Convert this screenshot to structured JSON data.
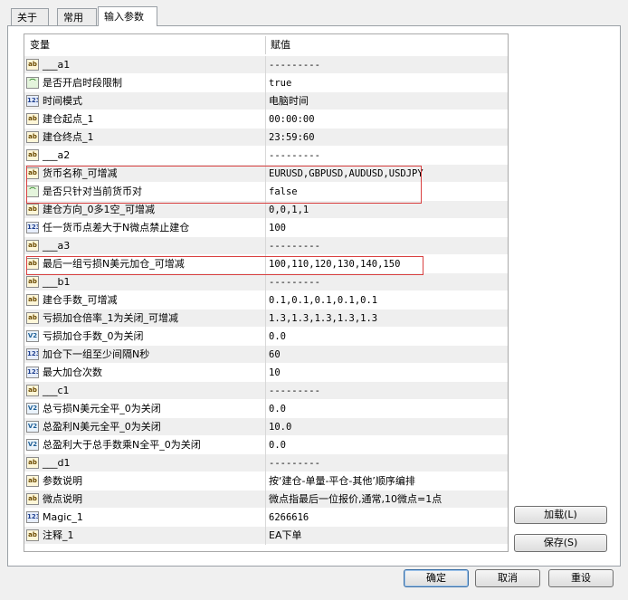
{
  "tabs": [
    "关于",
    "常用",
    "输入参数"
  ],
  "grid": {
    "columns": [
      "变量",
      "赋值"
    ],
    "rows": [
      {
        "icon": "ab",
        "name": "___a1",
        "value": "---------"
      },
      {
        "icon": "bool",
        "name": "是否开启时段限制",
        "value": "true"
      },
      {
        "icon": "123",
        "name": "时间模式",
        "value": "电脑时间"
      },
      {
        "icon": "ab",
        "name": "建仓起点_1",
        "value": "00:00:00"
      },
      {
        "icon": "ab",
        "name": "建仓终点_1",
        "value": "23:59:60"
      },
      {
        "icon": "ab",
        "name": "___a2",
        "value": "---------"
      },
      {
        "icon": "ab",
        "name": "货币名称_可增减",
        "value": "EURUSD,GBPUSD,AUDUSD,USDJPY"
      },
      {
        "icon": "bool",
        "name": "是否只针对当前货币对",
        "value": "false"
      },
      {
        "icon": "ab",
        "name": "建仓方向_0多1空_可增减",
        "value": "0,0,1,1"
      },
      {
        "icon": "123",
        "name": "任一货币点差大于N微点禁止建仓",
        "value": "100"
      },
      {
        "icon": "ab",
        "name": "___a3",
        "value": "---------"
      },
      {
        "icon": "ab",
        "name": "最后一组亏损N美元加仓_可增减",
        "value": "100,110,120,130,140,150"
      },
      {
        "icon": "ab",
        "name": "___b1",
        "value": "---------"
      },
      {
        "icon": "ab",
        "name": "建仓手数_可增减",
        "value": "0.1,0.1,0.1,0.1,0.1"
      },
      {
        "icon": "ab",
        "name": "亏损加仓倍率_1为关闭_可增减",
        "value": "1.3,1.3,1.3,1.3,1.3"
      },
      {
        "icon": "va",
        "name": "亏损加仓手数_0为关闭",
        "value": "0.0"
      },
      {
        "icon": "123",
        "name": "加仓下一组至少间隔N秒",
        "value": "60"
      },
      {
        "icon": "123",
        "name": "最大加仓次数",
        "value": "10"
      },
      {
        "icon": "ab",
        "name": "___c1",
        "value": "---------"
      },
      {
        "icon": "va",
        "name": "总亏损N美元全平_0为关闭",
        "value": "0.0"
      },
      {
        "icon": "va",
        "name": "总盈利N美元全平_0为关闭",
        "value": "10.0"
      },
      {
        "icon": "va",
        "name": "总盈利大于总手数乘N全平_0为关闭",
        "value": "0.0"
      },
      {
        "icon": "ab",
        "name": "___d1",
        "value": "---------"
      },
      {
        "icon": "ab",
        "name": "参数说明",
        "value": "按‘建仓-单量-平仓-其他’顺序编排"
      },
      {
        "icon": "ab",
        "name": "微点说明",
        "value": "微点指最后一位报价,通常,10微点=1点"
      },
      {
        "icon": "123",
        "name": "Magic_1",
        "value": "6266616"
      },
      {
        "icon": "ab",
        "name": "注释_1",
        "value": "EA下单"
      }
    ]
  },
  "icons": {
    "ab": "ab",
    "123": "123",
    "va": "V2",
    "bool": "⌒"
  },
  "buttons": {
    "load": "加载(L)",
    "save": "保存(S)",
    "ok": "确定",
    "cancel": "取消",
    "reset": "重设"
  },
  "colors": {
    "highlight_box": "#d94040",
    "alt_row": "#efefef"
  }
}
